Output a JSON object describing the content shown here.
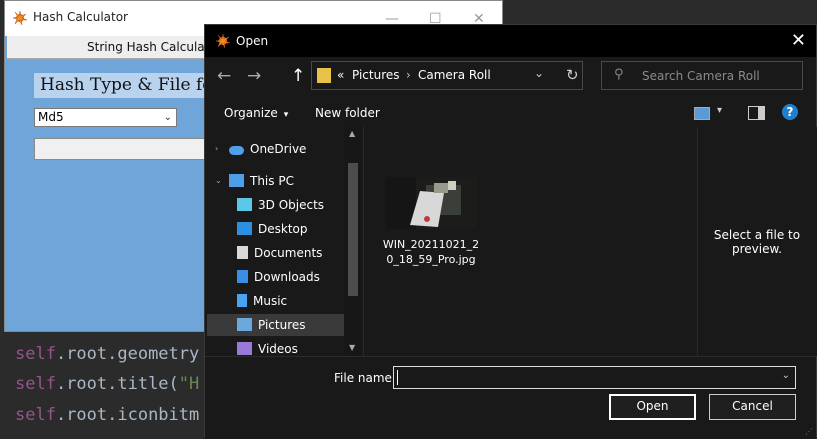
{
  "editor": {
    "lines": [
      {
        "self": "self",
        "rest": ".root.geometry"
      },
      {
        "self": "self",
        "rest": ".root.title(",
        "str": "\"H"
      },
      {
        "self": "self",
        "rest": ".root.iconbitm"
      }
    ]
  },
  "hash_window": {
    "title": "Hash Calculator",
    "controls": [
      "—",
      "☐",
      "✕"
    ],
    "tab": "String Hash Calculation",
    "header": "Hash Type & File for",
    "hash_type": "Md5",
    "hash_type_chevron": "⌄"
  },
  "dialog": {
    "title": "Open",
    "close": "✕",
    "nav": {
      "back": "←",
      "forward": "→",
      "up": "↑"
    },
    "address": {
      "prefix": "«",
      "crumbs": [
        "Pictures",
        "Camera Roll"
      ],
      "separator": "›",
      "chevron": "⌄",
      "refresh": "↻"
    },
    "search": {
      "icon": "⚲",
      "placeholder": "Search Camera Roll"
    },
    "toolbar": {
      "organize": "Organize",
      "new_folder": "New folder",
      "caret": "▾",
      "help": "?"
    },
    "nav_pane": [
      {
        "label": "OneDrive",
        "icon": "onedrive-icon",
        "color": "#4f9ee8"
      },
      {
        "label": "This PC",
        "icon": "this-pc-icon",
        "color": "#4f9ee8"
      },
      {
        "label": "3D Objects",
        "icon": "3d-objects-icon",
        "color": "#5bc8e8"
      },
      {
        "label": "Desktop",
        "icon": "desktop-icon",
        "color": "#2d8fe0"
      },
      {
        "label": "Documents",
        "icon": "documents-icon",
        "color": "#d9d9d9"
      },
      {
        "label": "Downloads",
        "icon": "downloads-icon",
        "color": "#3b8ee6"
      },
      {
        "label": "Music",
        "icon": "music-icon",
        "color": "#4aa3f0"
      },
      {
        "label": "Pictures",
        "icon": "pictures-icon",
        "color": "#6aa9de"
      },
      {
        "label": "Videos",
        "icon": "videos-icon",
        "color": "#9a7ad8"
      }
    ],
    "files": [
      {
        "name": "WIN_20211021_20_18_59_Pro.jpg",
        "name_line1": "WIN_20211021_2",
        "name_line2": "0_18_59_Pro.jpg"
      }
    ],
    "preview_text": "Select a file to preview.",
    "file_name_label": "File name:",
    "file_name_value": "",
    "open_label": "Open",
    "cancel_label": "Cancel"
  }
}
